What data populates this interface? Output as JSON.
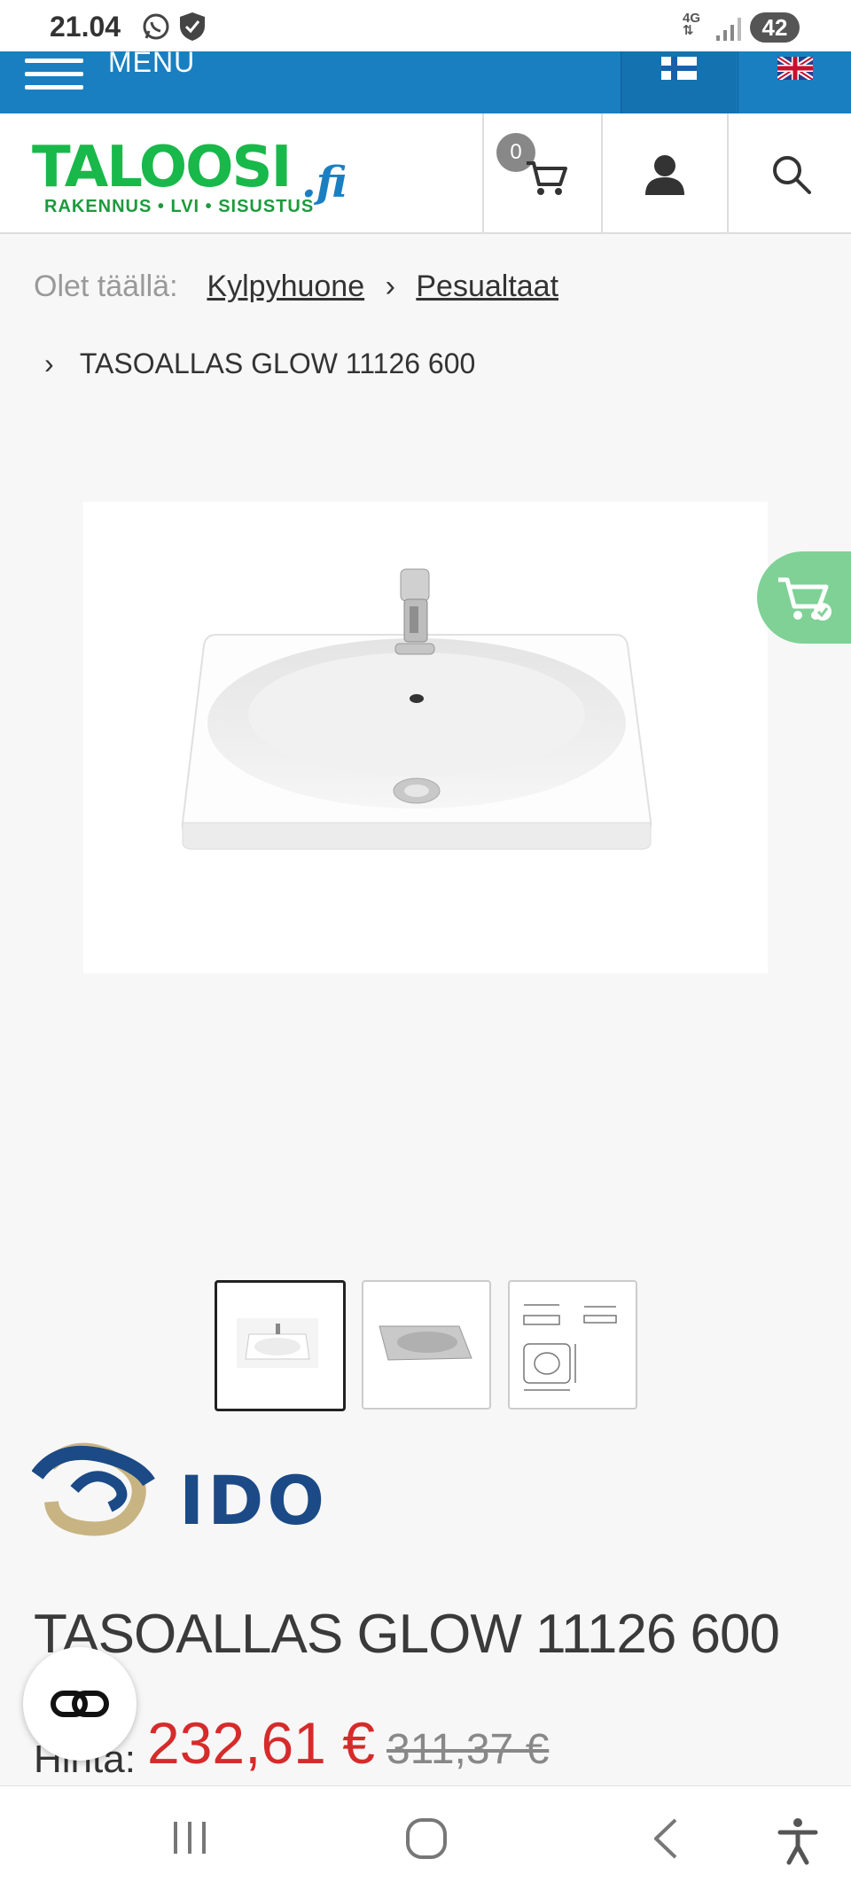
{
  "status_bar": {
    "time": "21.04",
    "network": "4G",
    "battery": "42"
  },
  "top_nav": {
    "menu_label": "MENU",
    "languages": [
      "fi",
      "en"
    ]
  },
  "header": {
    "logo_main": "TALOOSI",
    "logo_suffix": ".fi",
    "logo_tagline": "RAKENNUS • LVI • SISUSTUS",
    "cart_count": "0"
  },
  "breadcrumb": {
    "prefix": "Olet täällä:",
    "items": [
      "Kylpyhuone",
      "Pesualtaat"
    ],
    "separator": "›",
    "current": "TASOALLAS GLOW 11126 600"
  },
  "gallery": {
    "thumbnail_count": 3,
    "active_index": 0
  },
  "brand": {
    "name": "IDO"
  },
  "product": {
    "title": "TASOALLAS GLOW 11126 600",
    "price_label": "Hinta:",
    "price": "232,61 €",
    "old_price": "311,37 €"
  },
  "colors": {
    "brand_blue": "#1a7fc1",
    "brand_green": "#19b84a",
    "sale_red": "#d62b2b",
    "fab_green": "#7fd196"
  }
}
